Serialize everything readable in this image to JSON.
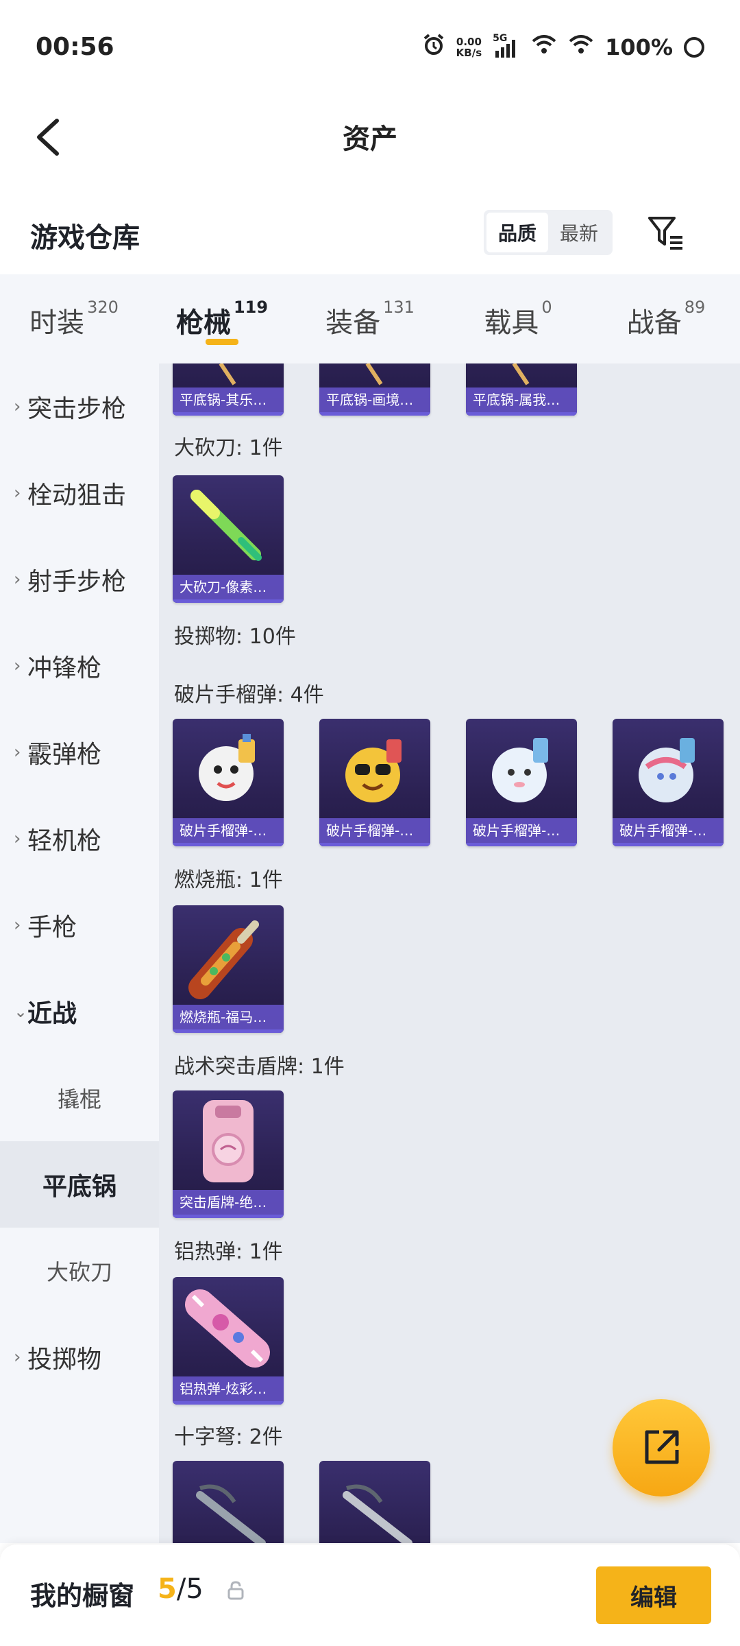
{
  "status_bar": {
    "time": "00:56",
    "net_speed_value": "0.00",
    "net_speed_unit": "KB/s",
    "network_type": "5G",
    "battery": "100%"
  },
  "header": {
    "title": "资产"
  },
  "warehouse": {
    "title": "游戏仓库",
    "sort_options": [
      "品质",
      "最新"
    ],
    "sort_selected": "品质"
  },
  "category_tabs": [
    {
      "label": "时装",
      "count": "320",
      "active": false
    },
    {
      "label": "枪械",
      "count": "119",
      "active": true
    },
    {
      "label": "装备",
      "count": "131",
      "active": false
    },
    {
      "label": "载具",
      "count": "0",
      "active": false
    },
    {
      "label": "战备",
      "count": "89",
      "active": false
    }
  ],
  "sidebar": {
    "items": [
      {
        "label": "突击步枪"
      },
      {
        "label": "栓动狙击"
      },
      {
        "label": "射手步枪"
      },
      {
        "label": "冲锋枪"
      },
      {
        "label": "霰弹枪"
      },
      {
        "label": "轻机枪"
      },
      {
        "label": "手枪"
      },
      {
        "label": "近战"
      },
      {
        "label": "投掷物"
      }
    ],
    "sub_items": [
      {
        "label": "撬棍"
      },
      {
        "label": "平底锅"
      },
      {
        "label": "大砍刀"
      }
    ]
  },
  "content": {
    "top_partial_cards": [
      "平底锅-其乐…",
      "平底锅-画境…",
      "平底锅-属我…"
    ],
    "groups": [
      {
        "label": "大砍刀: 1件",
        "cards": [
          "大砍刀-像素…"
        ]
      },
      {
        "label": "投掷物: 10件"
      },
      {
        "label": "破片手榴弹: 4件",
        "cards": [
          "破片手榴弹-…",
          "破片手榴弹-…",
          "破片手榴弹-…",
          "破片手榴弹-…"
        ]
      },
      {
        "label": "燃烧瓶: 1件",
        "cards": [
          "燃烧瓶-福马…"
        ]
      },
      {
        "label": "战术突击盾牌: 1件",
        "cards": [
          "突击盾牌-绝…"
        ]
      },
      {
        "label": "铝热弹: 1件",
        "cards": [
          "铝热弹-炫彩…"
        ]
      },
      {
        "label": "十字弩: 2件"
      }
    ]
  },
  "showcase": {
    "title": "我的橱窗",
    "current": "5",
    "total": "/5",
    "edit_label": "编辑"
  },
  "colors": {
    "accent": "#f5b319",
    "card_bg": "#2b2152",
    "card_caption": "#6755cc"
  },
  "icons": [
    "back-arrow-icon",
    "filter-icon",
    "alarm-icon",
    "signal-icon",
    "wifi-icon",
    "battery-icon",
    "chevron-right-icon",
    "chevron-down-icon",
    "share-icon",
    "lock-icon"
  ]
}
